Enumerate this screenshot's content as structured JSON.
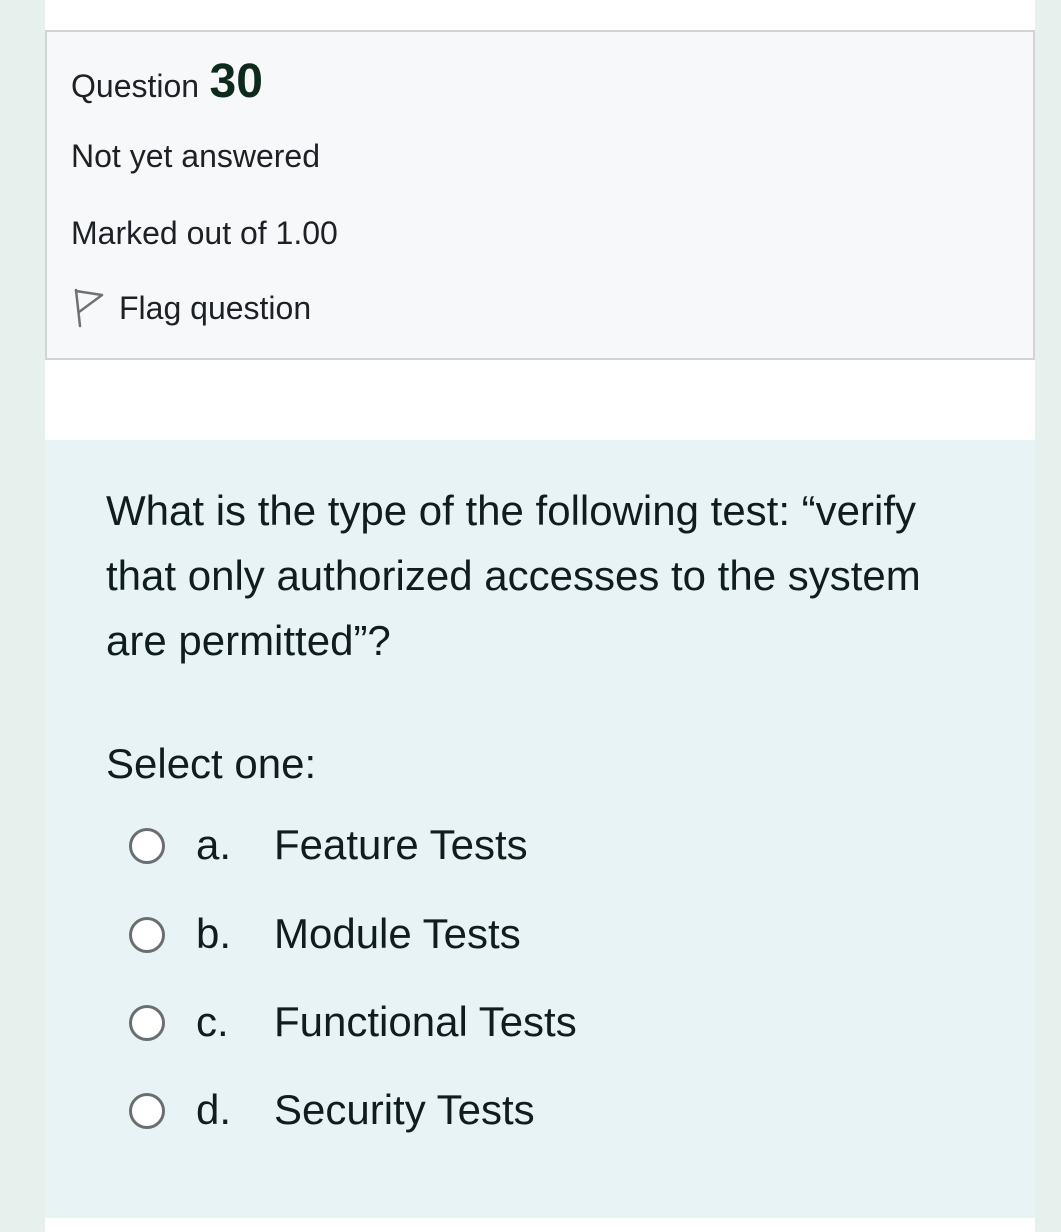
{
  "question_info": {
    "label": "Question",
    "number": "30",
    "state": "Not yet answered",
    "grade": "Marked out of 1.00",
    "flag_label": "Flag question",
    "flag_icon": "flag-outline-icon"
  },
  "question": {
    "text": "What is the type of the following test: “verify that only authorized accesses to the system are permitted”?",
    "prompt": "Select one:",
    "answers": [
      {
        "letter": "a.",
        "text": "Feature Tests"
      },
      {
        "letter": "b.",
        "text": "Module Tests"
      },
      {
        "letter": "c.",
        "text": "Functional Tests"
      },
      {
        "letter": "d.",
        "text": "Security Tests"
      }
    ]
  },
  "colors": {
    "info_bg": "#f6f8f9",
    "content_bg": "#e7f3f5",
    "outer_bg": "#e6f1ee",
    "number_color": "#0f2a1c"
  }
}
